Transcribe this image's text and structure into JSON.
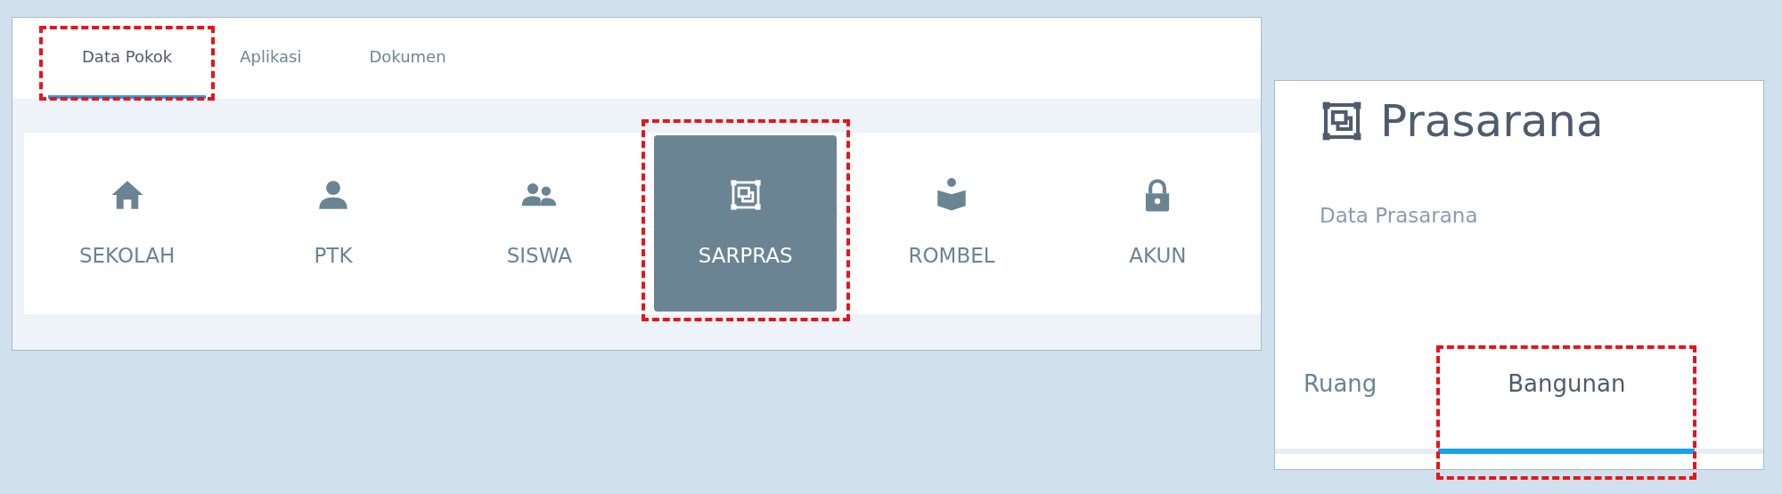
{
  "main_tabs": [
    {
      "label": "Data Pokok",
      "selected": true,
      "highlighted": true
    },
    {
      "label": "Aplikasi",
      "selected": false,
      "highlighted": false
    },
    {
      "label": "Dokumen",
      "selected": false,
      "highlighted": false
    }
  ],
  "modules": [
    {
      "label": "SEKOLAH",
      "kind": "home",
      "selected": false,
      "highlighted": false
    },
    {
      "label": "PTK",
      "kind": "person",
      "selected": false,
      "highlighted": false
    },
    {
      "label": "SISWA",
      "kind": "people",
      "selected": false,
      "highlighted": false
    },
    {
      "label": "SARPRAS",
      "kind": "frame",
      "selected": true,
      "highlighted": true
    },
    {
      "label": "ROMBEL",
      "kind": "reader",
      "selected": false,
      "highlighted": false
    },
    {
      "label": "AKUN",
      "kind": "lock",
      "selected": false,
      "highlighted": false
    }
  ],
  "detail": {
    "title": "Prasarana",
    "subtitle": "Data Prasarana",
    "tabs": [
      {
        "label": "Ruang",
        "selected": false,
        "highlighted": false
      },
      {
        "label": "Bangunan",
        "selected": true,
        "highlighted": true
      }
    ]
  }
}
